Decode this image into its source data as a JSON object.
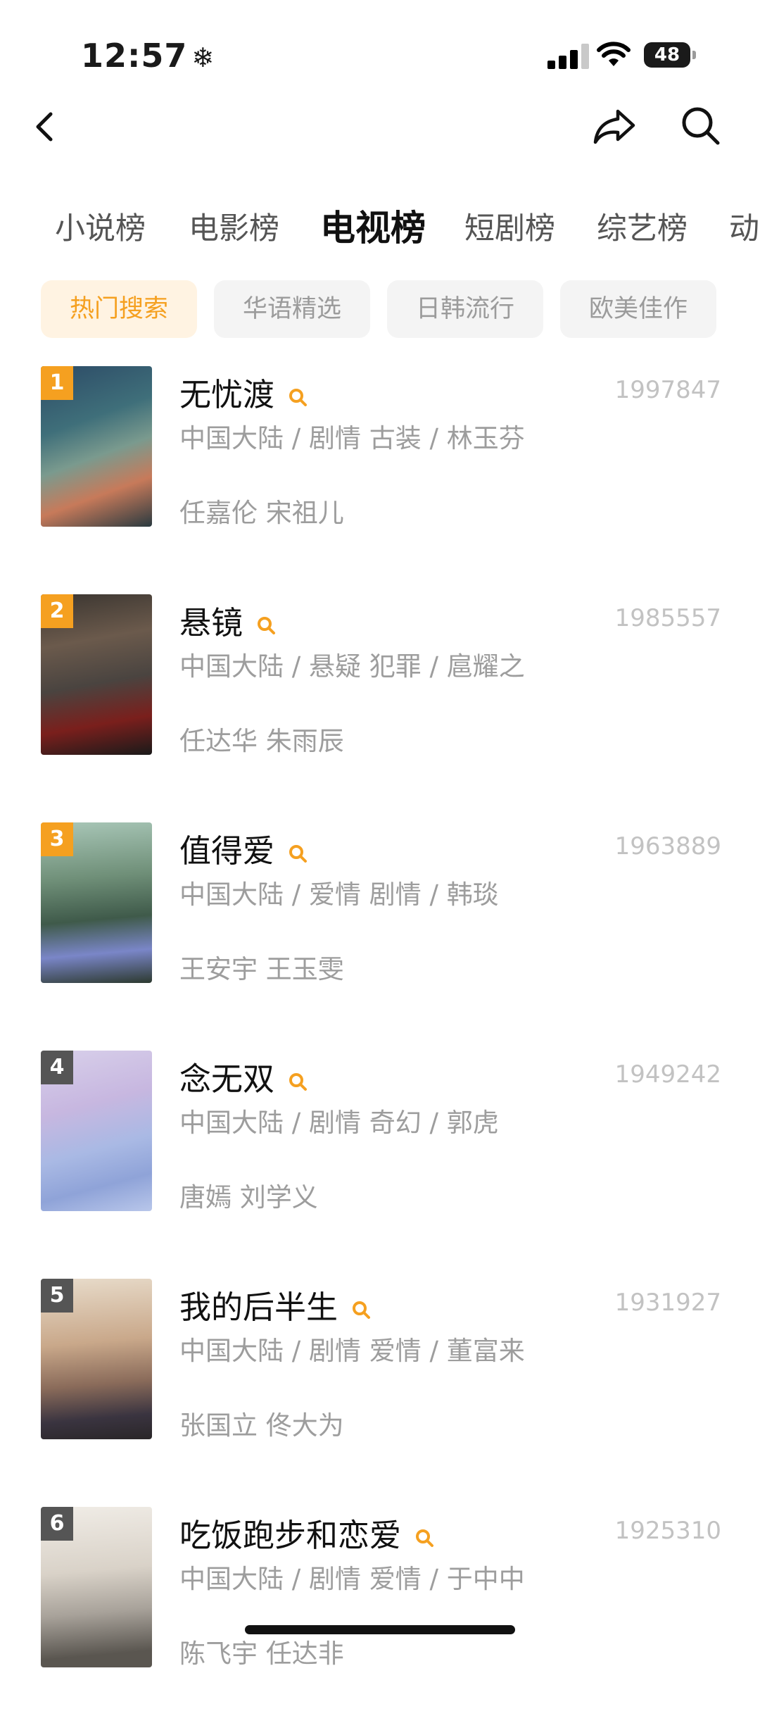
{
  "status": {
    "time": "12:57",
    "snow": "❄",
    "battery": "48"
  },
  "tabs": [
    "小说榜",
    "电影榜",
    "电视榜",
    "短剧榜",
    "综艺榜",
    "动"
  ],
  "active_tab": 2,
  "chips": [
    "热门搜索",
    "华语精选",
    "日韩流行",
    "欧美佳作"
  ],
  "colors": {
    "accent": "#f5a020",
    "rank_top": "#f5a020",
    "rank_other": "#555555"
  },
  "items": [
    {
      "rank": "1",
      "title": "无忧渡",
      "meta": "中国大陆 / 剧情 古装 / 林玉芬",
      "cast": "任嘉伦 宋祖儿",
      "count": "1997847"
    },
    {
      "rank": "2",
      "title": "悬镜",
      "meta": "中国大陆 / 悬疑 犯罪 / 扈耀之",
      "cast": "任达华 朱雨辰",
      "count": "1985557"
    },
    {
      "rank": "3",
      "title": "值得爱",
      "meta": "中国大陆 / 爱情 剧情 / 韩琰",
      "cast": "王安宇 王玉雯",
      "count": "1963889"
    },
    {
      "rank": "4",
      "title": "念无双",
      "meta": "中国大陆 / 剧情 奇幻 / 郭虎",
      "cast": "唐嫣 刘学义",
      "count": "1949242"
    },
    {
      "rank": "5",
      "title": "我的后半生",
      "meta": "中国大陆 / 剧情 爱情 / 董富来",
      "cast": "张国立 佟大为",
      "count": "1931927"
    },
    {
      "rank": "6",
      "title": "吃饭跑步和恋爱",
      "meta": "中国大陆 / 剧情 爱情 / 于中中",
      "cast": "陈飞宇 任达非",
      "count": "1925310"
    }
  ]
}
